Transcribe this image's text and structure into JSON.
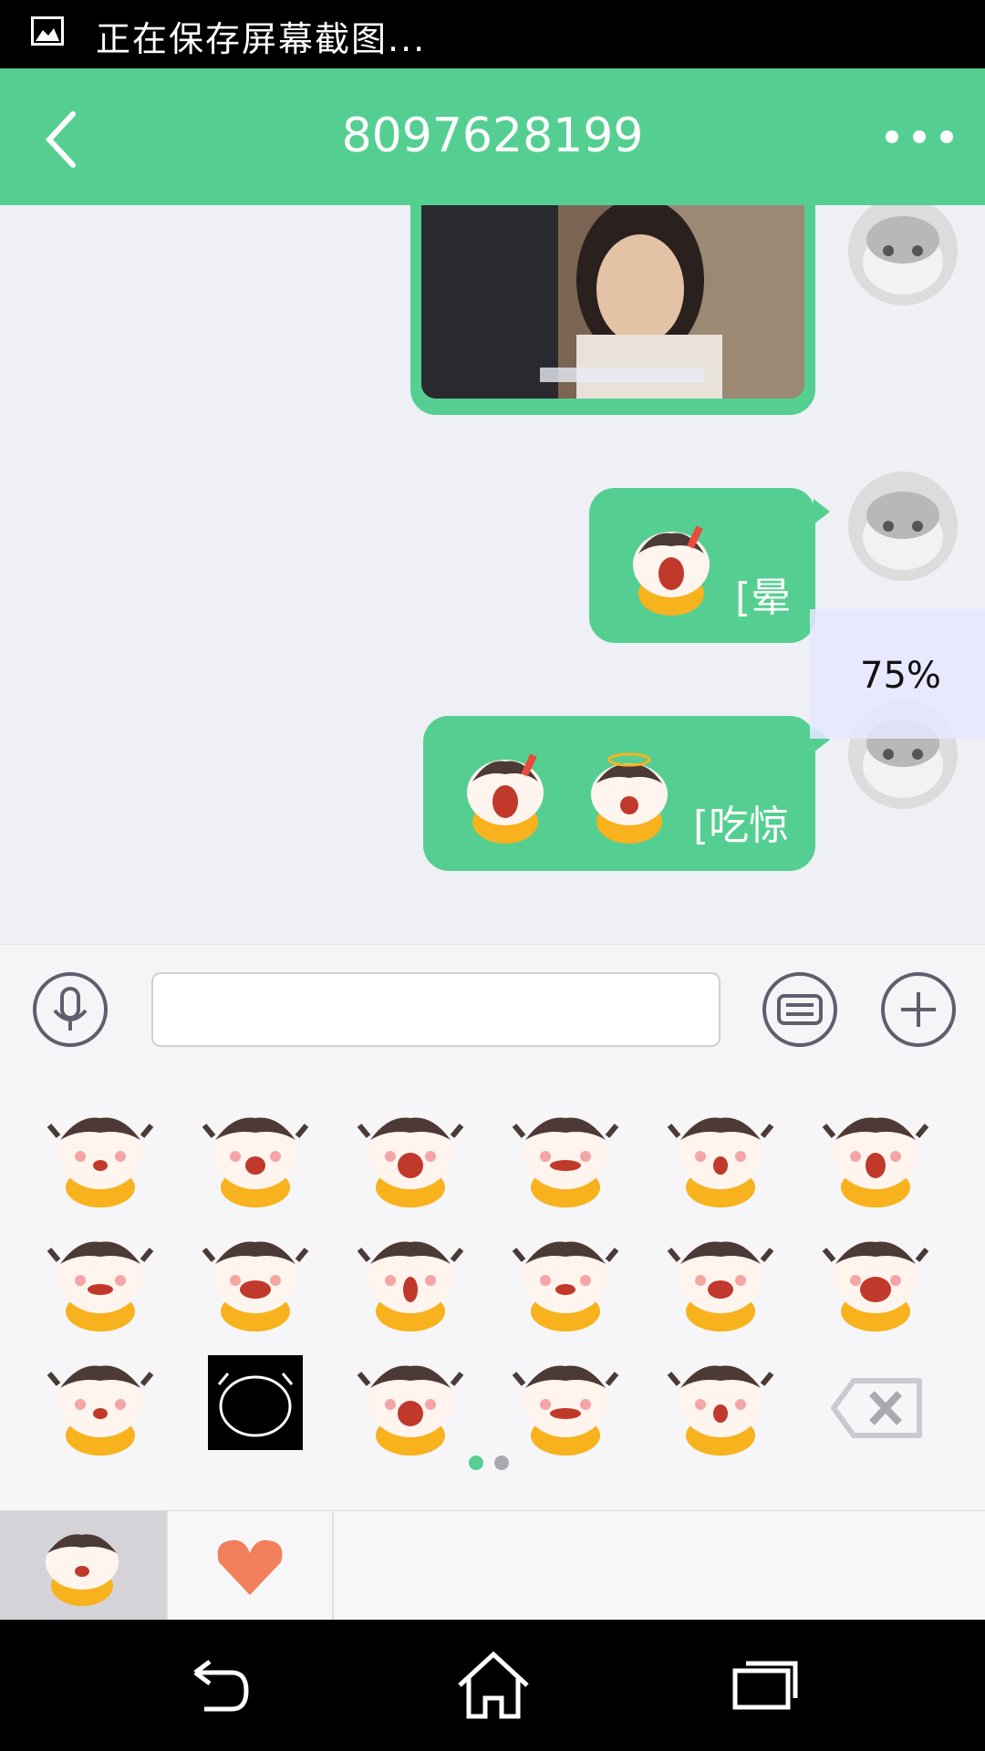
{
  "status_bar": {
    "text": "正在保存屏幕截图...",
    "icon": "image-icon"
  },
  "app_bar": {
    "title": "8097628199",
    "back_icon": "chevron-left-icon",
    "more_icon": "more-dots-icon"
  },
  "messages": [
    {
      "type": "image"
    },
    {
      "type": "emoji",
      "text": "[晕"
    },
    {
      "type": "emoji",
      "text": "[吃惊"
    }
  ],
  "progress": {
    "label": "75%"
  },
  "input_bar": {
    "voice_icon": "microphone-icon",
    "keyboard_icon": "keyboard-icon",
    "add_icon": "plus-icon",
    "text_value": ""
  },
  "emoji_panel": {
    "page_count": 2,
    "current_page": 1,
    "delete_icon": "backspace-icon"
  },
  "tabs": [
    {
      "icon": "cow-sticker-icon",
      "selected": true
    },
    {
      "icon": "heart-icon",
      "selected": false
    }
  ],
  "nav_bar": {
    "back": "back-icon",
    "home": "home-icon",
    "recents": "recents-icon"
  },
  "colors": {
    "accent": "#55cf91",
    "sticker_yellow": "#f7b21d"
  }
}
